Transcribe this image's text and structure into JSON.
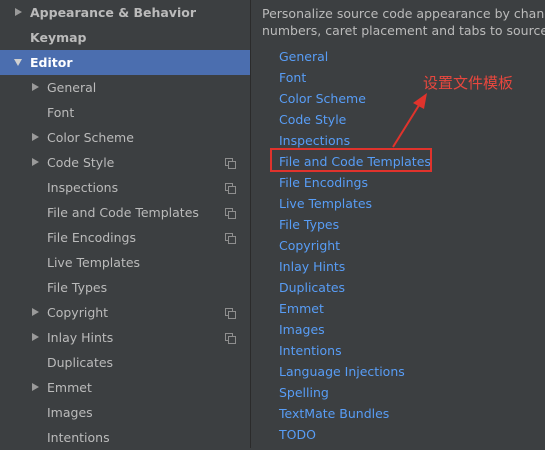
{
  "sidebar": {
    "items": [
      {
        "label": "Appearance & Behavior",
        "bold": true,
        "arrow": "right"
      },
      {
        "label": "Keymap",
        "bold": true,
        "arrow": "none"
      },
      {
        "label": "Editor",
        "bold": true,
        "arrow": "down",
        "selected": true
      },
      {
        "label": "General",
        "arrow": "right"
      },
      {
        "label": "Font",
        "arrow": "none"
      },
      {
        "label": "Color Scheme",
        "arrow": "right"
      },
      {
        "label": "Code Style",
        "arrow": "right",
        "copy_icon": true
      },
      {
        "label": "Inspections",
        "arrow": "none",
        "copy_icon": true
      },
      {
        "label": "File and Code Templates",
        "arrow": "none",
        "copy_icon": true
      },
      {
        "label": "File Encodings",
        "arrow": "none",
        "copy_icon": true
      },
      {
        "label": "Live Templates",
        "arrow": "none"
      },
      {
        "label": "File Types",
        "arrow": "none"
      },
      {
        "label": "Copyright",
        "arrow": "right",
        "copy_icon": true
      },
      {
        "label": "Inlay Hints",
        "arrow": "right",
        "copy_icon": true
      },
      {
        "label": "Duplicates",
        "arrow": "none"
      },
      {
        "label": "Emmet",
        "arrow": "right"
      },
      {
        "label": "Images",
        "arrow": "none"
      },
      {
        "label": "Intentions",
        "arrow": "none"
      }
    ]
  },
  "content": {
    "description_line1": "Personalize source code appearance by changin",
    "description_line2": "numbers, caret placement and tabs to source co",
    "links": [
      "General",
      "Font",
      "Color Scheme",
      "Code Style",
      "Inspections",
      "File and Code Templates",
      "File Encodings",
      "Live Templates",
      "File Types",
      "Copyright",
      "Inlay Hints",
      "Duplicates",
      "Emmet",
      "Images",
      "Intentions",
      "Language Injections",
      "Spelling",
      "TextMate Bundles",
      "TODO"
    ],
    "annotation": "设置文件模板"
  },
  "colors": {
    "background": "#3c3f41",
    "selection": "#4b6eaf",
    "link": "#589df6",
    "annotation_red": "#e0332c"
  }
}
